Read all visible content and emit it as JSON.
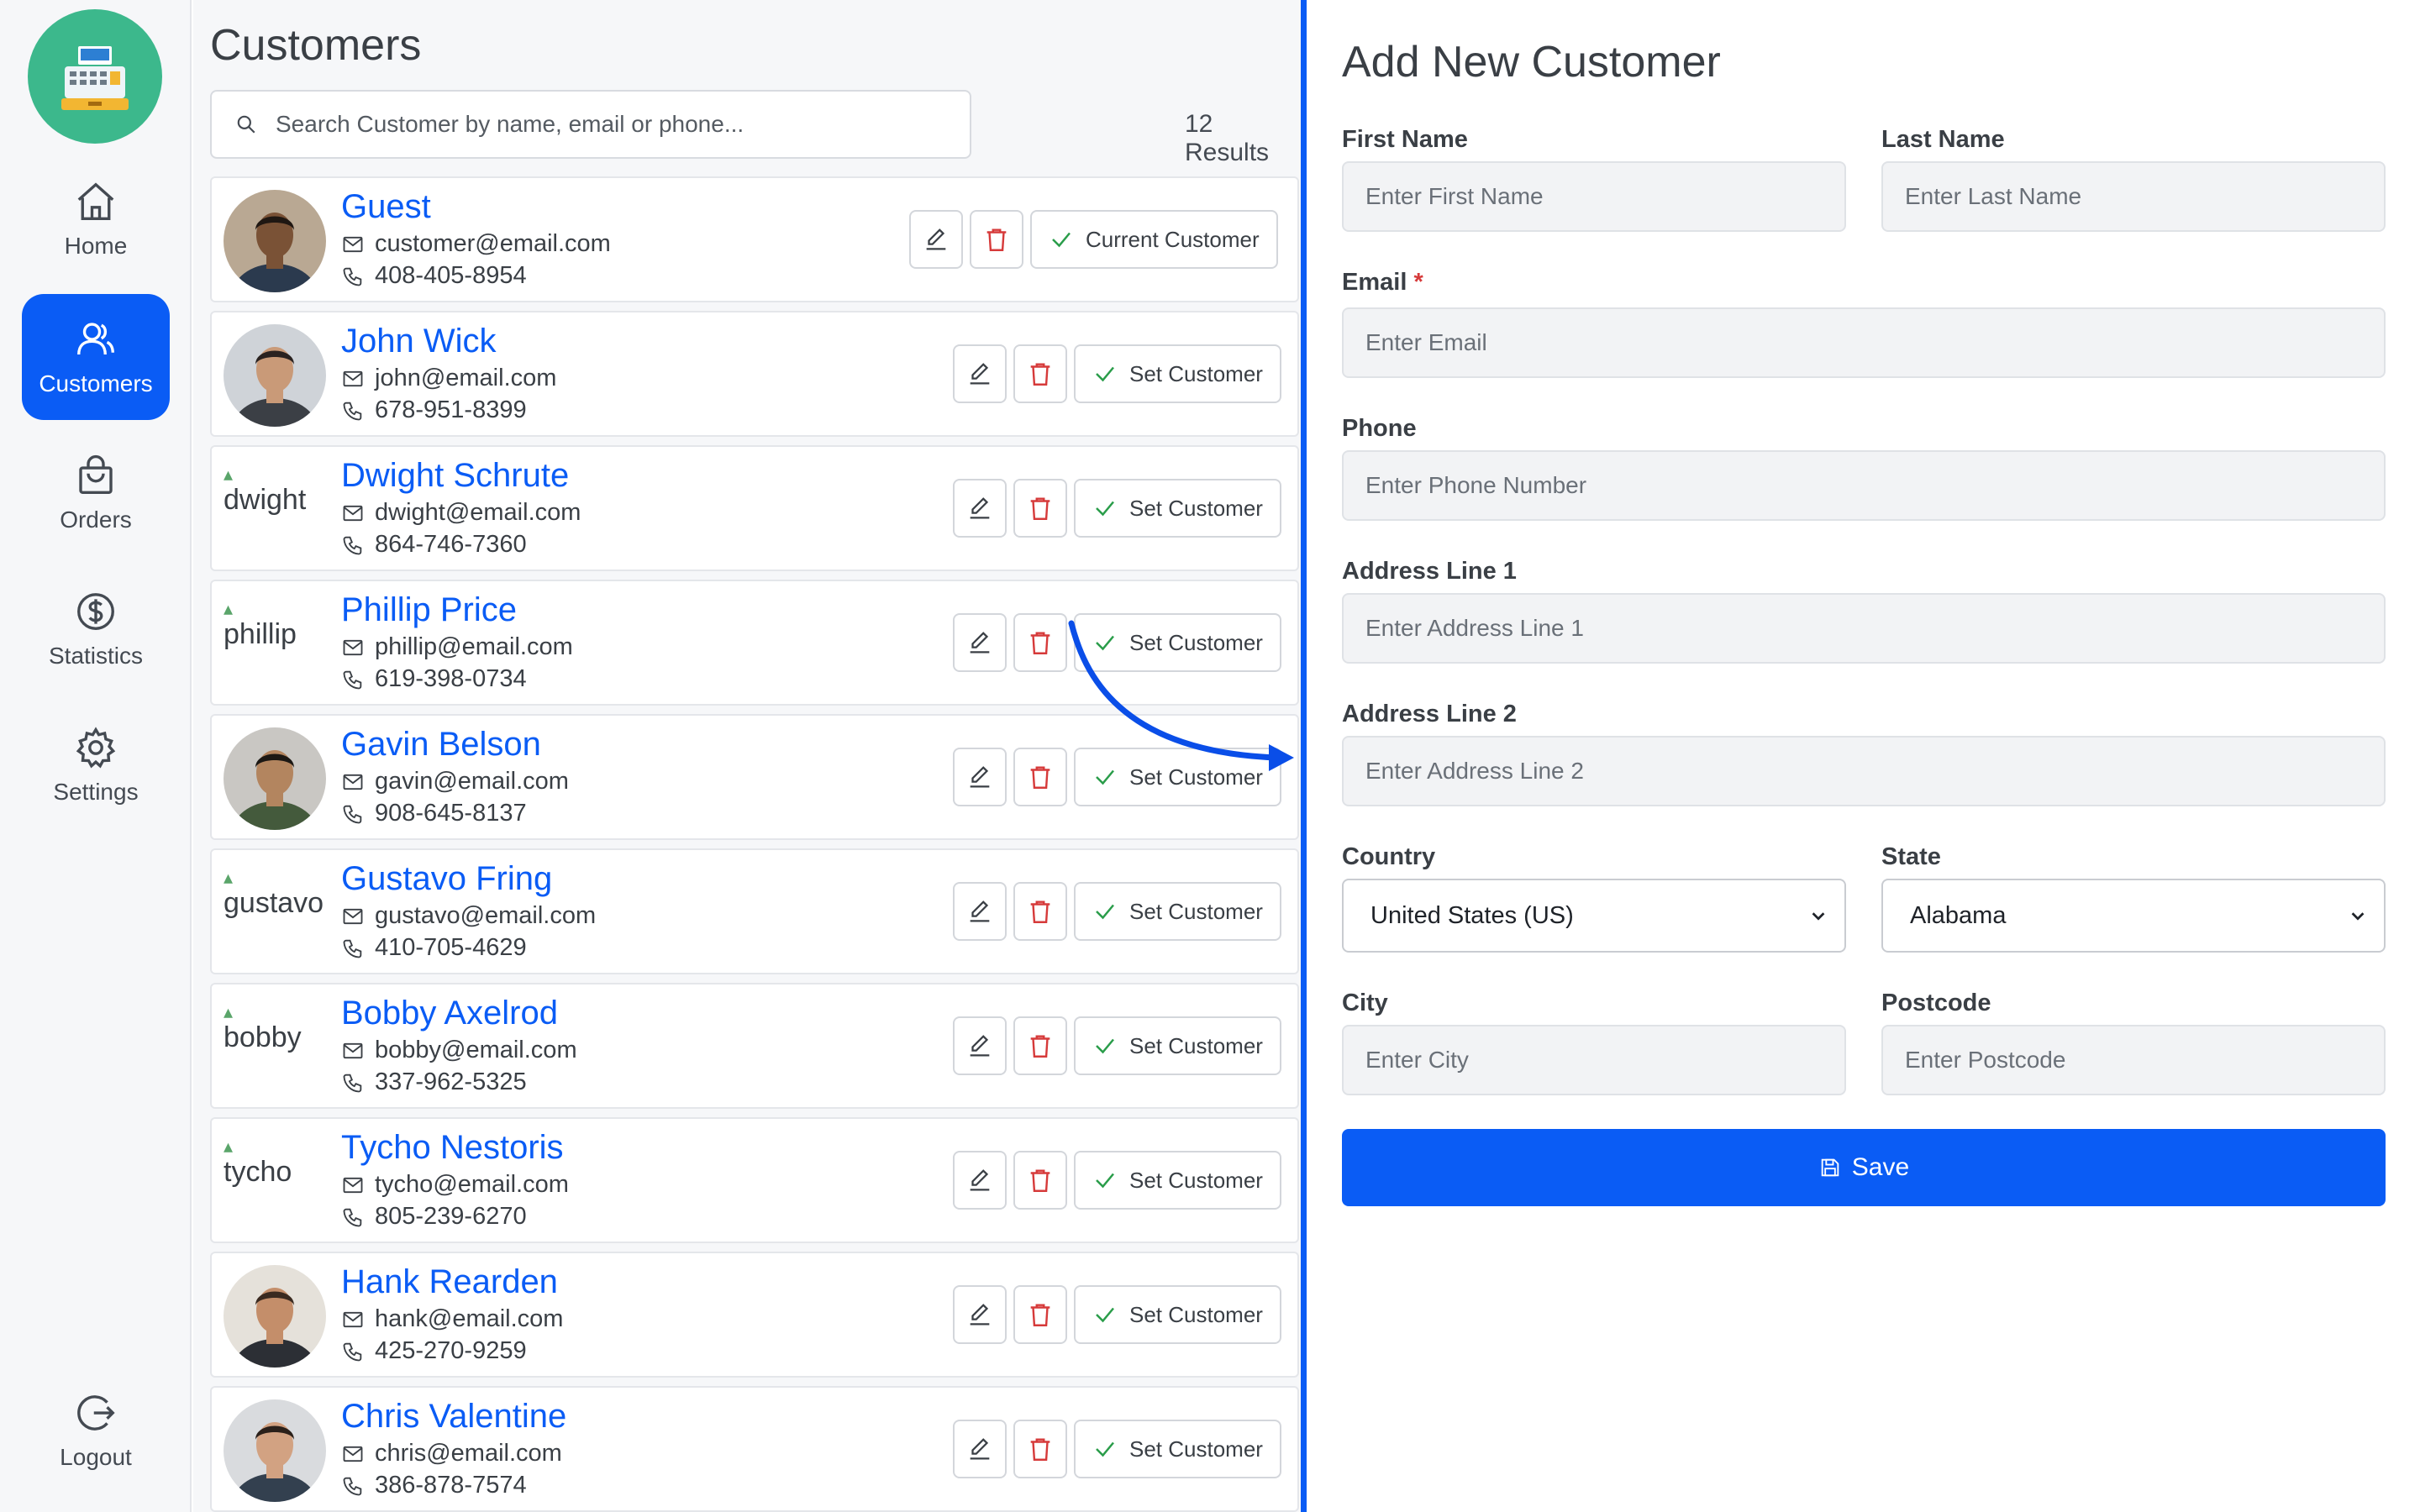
{
  "sidebar": {
    "items": [
      {
        "label": "Home",
        "icon": "home-icon"
      },
      {
        "label": "Customers",
        "icon": "customers-icon",
        "active": true
      },
      {
        "label": "Orders",
        "icon": "shopping-bag-icon"
      },
      {
        "label": "Statistics",
        "icon": "dollar-icon"
      },
      {
        "label": "Settings",
        "icon": "gear-icon"
      }
    ],
    "logout": {
      "label": "Logout",
      "icon": "logout-icon"
    }
  },
  "main": {
    "title": "Customers",
    "search_placeholder": "Search Customer by name, email or phone...",
    "results": "12 Results",
    "current_label": "Current Customer",
    "set_label": "Set Customer",
    "customers": [
      {
        "name": "Guest",
        "email": "customer@email.com",
        "phone": "408-405-8954",
        "avatar": "photo",
        "current": true
      },
      {
        "name": "John Wick",
        "email": "john@email.com",
        "phone": "678-951-8399",
        "avatar": "photo"
      },
      {
        "name": "Dwight Schrute",
        "email": "dwight@email.com",
        "phone": "864-746-7360",
        "avatar_alt": "dwight"
      },
      {
        "name": "Phillip Price",
        "email": "phillip@email.com",
        "phone": "619-398-0734",
        "avatar_alt": "phillip"
      },
      {
        "name": "Gavin Belson",
        "email": "gavin@email.com",
        "phone": "908-645-8137",
        "avatar": "photo"
      },
      {
        "name": "Gustavo Fring",
        "email": "gustavo@email.com",
        "phone": "410-705-4629",
        "avatar_alt": "gustavo"
      },
      {
        "name": "Bobby Axelrod",
        "email": "bobby@email.com",
        "phone": "337-962-5325",
        "avatar_alt": "bobby"
      },
      {
        "name": "Tycho Nestoris",
        "email": "tycho@email.com",
        "phone": "805-239-6270",
        "avatar_alt": "tycho"
      },
      {
        "name": "Hank Rearden",
        "email": "hank@email.com",
        "phone": "425-270-9259",
        "avatar": "photo"
      },
      {
        "name": "Chris Valentine",
        "email": "chris@email.com",
        "phone": "386-878-7574",
        "avatar": "photo"
      }
    ]
  },
  "form": {
    "title": "Add New Customer",
    "first_name": {
      "label": "First Name",
      "placeholder": "Enter First Name"
    },
    "last_name": {
      "label": "Last Name",
      "placeholder": "Enter Last Name"
    },
    "email": {
      "label": "Email",
      "required": "*",
      "placeholder": "Enter Email"
    },
    "phone": {
      "label": "Phone",
      "placeholder": "Enter Phone Number"
    },
    "address1": {
      "label": "Address Line 1",
      "placeholder": "Enter Address Line 1"
    },
    "address2": {
      "label": "Address Line 2",
      "placeholder": "Enter Address Line 2"
    },
    "country": {
      "label": "Country",
      "value": "United States (US)"
    },
    "state": {
      "label": "State",
      "value": "Alabama"
    },
    "city": {
      "label": "City",
      "placeholder": "Enter City"
    },
    "postcode": {
      "label": "Postcode",
      "placeholder": "Enter Postcode"
    },
    "save_label": "Save"
  },
  "colors": {
    "accent": "#0a5cf5",
    "logo": "#3cb88c",
    "delete": "#d63a3a",
    "check": "#2a9d4a"
  }
}
